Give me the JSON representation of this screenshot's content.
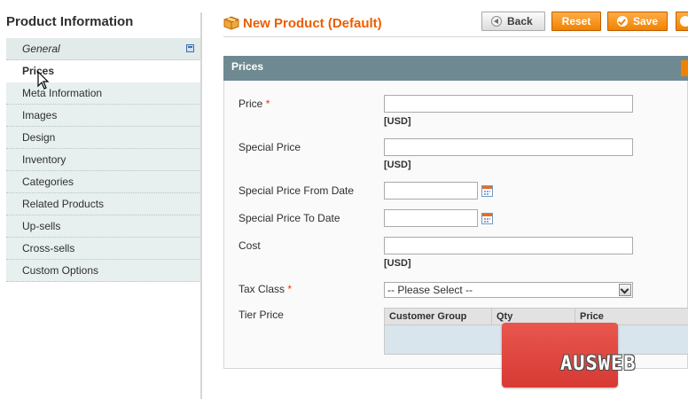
{
  "sidebar": {
    "title": "Product Information",
    "tabs": [
      {
        "label": "General"
      },
      {
        "label": "Prices"
      },
      {
        "label": "Meta Information"
      },
      {
        "label": "Images"
      },
      {
        "label": "Design"
      },
      {
        "label": "Inventory"
      },
      {
        "label": "Categories"
      },
      {
        "label": "Related Products"
      },
      {
        "label": "Up-sells"
      },
      {
        "label": "Cross-sells"
      },
      {
        "label": "Custom Options"
      }
    ]
  },
  "header": {
    "title": "New Product (Default)",
    "back_label": "Back",
    "reset_label": "Reset",
    "save_label": "Save"
  },
  "prices": {
    "section_title": "Prices",
    "price_label": "Price",
    "special_price_label": "Special Price",
    "special_from_label": "Special Price From Date",
    "special_to_label": "Special Price To Date",
    "cost_label": "Cost",
    "tax_class_label": "Tax Class",
    "tax_class_selected": "-- Please Select --",
    "tier_price_label": "Tier Price",
    "currency": "[USD]",
    "required_mark": "*",
    "price_value": "",
    "special_price_value": "",
    "special_from_value": "",
    "special_to_value": "",
    "cost_value": "",
    "tier_columns": [
      "Customer Group",
      "Qty",
      "Price"
    ]
  },
  "watermark": {
    "text": "AUSWEB"
  },
  "colors": {
    "accent": "#eb5e00",
    "section_header": "#6f8992",
    "button_orange": "#f18200",
    "tab_bg": "#e7efef",
    "watermark_red": "#d63a33"
  }
}
